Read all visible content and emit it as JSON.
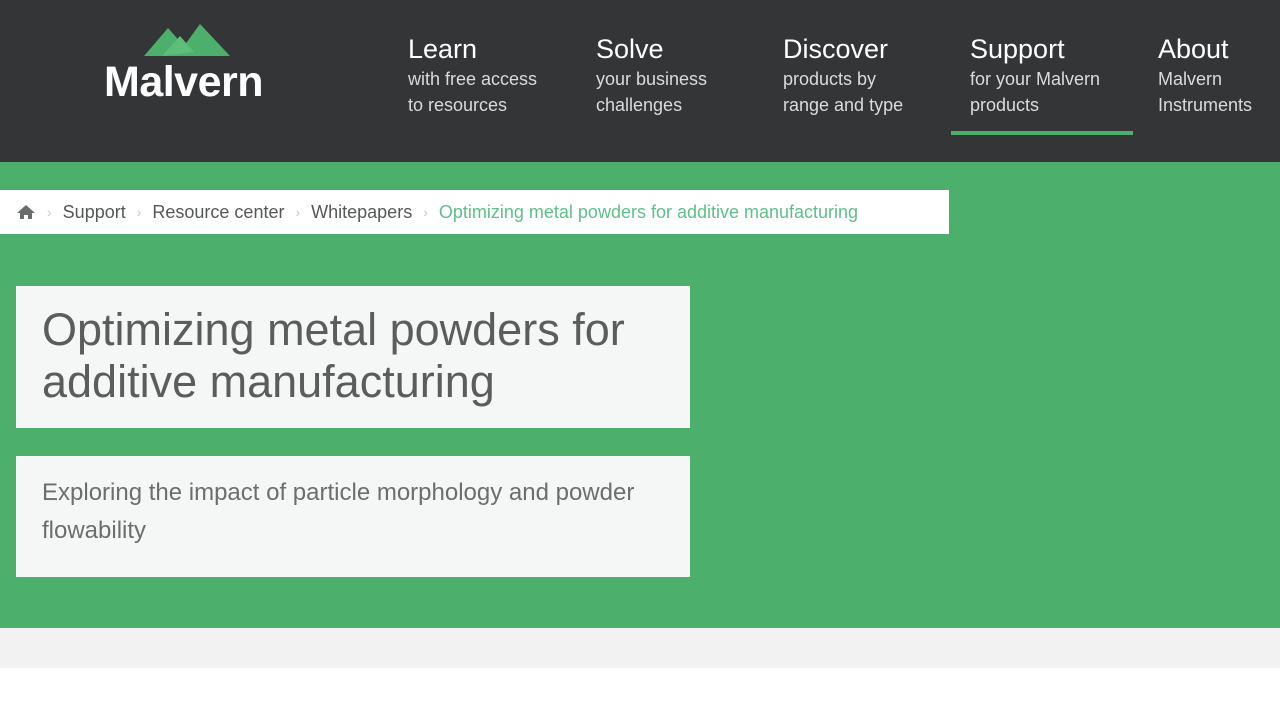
{
  "header": {
    "logo_text": "Malvern",
    "nav": [
      {
        "title": "Learn",
        "sub": "with free access to resources"
      },
      {
        "title": "Solve",
        "sub": "your business challenges"
      },
      {
        "title": "Discover",
        "sub": "products by range and type"
      },
      {
        "title": "Support",
        "sub": "for your Malvern products"
      },
      {
        "title": "About",
        "sub": "Malvern Instruments"
      }
    ],
    "active_nav": "Support"
  },
  "breadcrumb": {
    "items": [
      "Support",
      "Resource center",
      "Whitepapers"
    ],
    "current": "Optimizing metal powders for additive manufacturing"
  },
  "page": {
    "title": "Optimizing metal powders for additive manufacturing",
    "subtitle": "Exploring the impact of particle morphology and powder flowability"
  },
  "colors": {
    "header_bg": "#333536",
    "accent_green": "#4caf6b",
    "breadcrumb_current": "#5fbf8a"
  },
  "icons": [
    "home-icon",
    "chevron-right-icon",
    "malvern-mountain-logo-icon"
  ]
}
